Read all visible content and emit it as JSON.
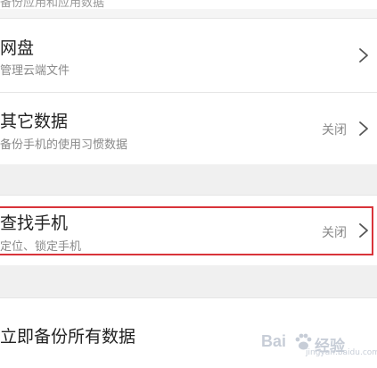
{
  "top_cutoff": {
    "text": "备份应用和应用数据"
  },
  "rows": [
    {
      "title": "网盘",
      "subtitle": "管理云端文件",
      "status": ""
    },
    {
      "title": "其它数据",
      "subtitle": "备份手机的使用习惯数据",
      "status": "关闭"
    },
    {
      "title": "查找手机",
      "subtitle": "定位、锁定手机",
      "status": "关闭"
    }
  ],
  "action": {
    "label": "立即备份所有数据"
  },
  "watermark": {
    "brand": "Bai",
    "suffix": "经验",
    "url": "jingyan.baidu.com"
  },
  "colors": {
    "highlight_border": "#d9343a",
    "background": "#f0f0f0",
    "row_background": "#ffffff"
  },
  "icons": {
    "row_arrow": "chevron-right-icon",
    "watermark": "paw-icon"
  }
}
